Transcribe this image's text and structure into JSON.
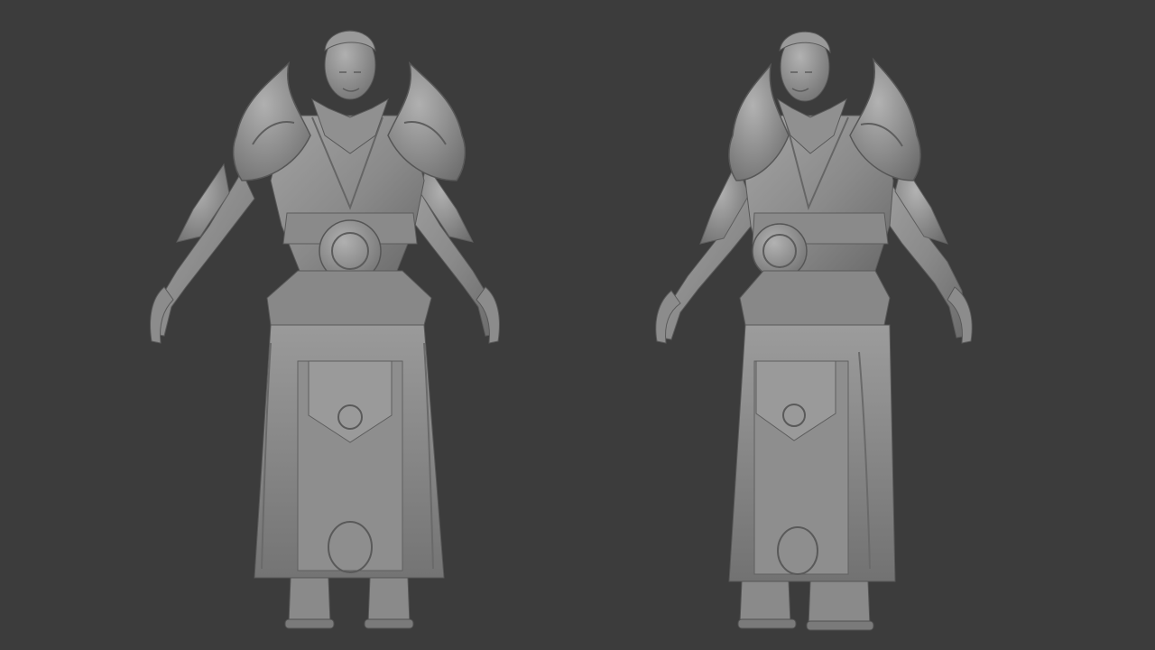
{
  "scene": {
    "background_color": "#3c3c3c",
    "material_color": "#8e8e8e",
    "views": [
      {
        "id": "front",
        "pose": "a-pose"
      },
      {
        "id": "three-quarter",
        "pose": "a-pose"
      }
    ]
  }
}
